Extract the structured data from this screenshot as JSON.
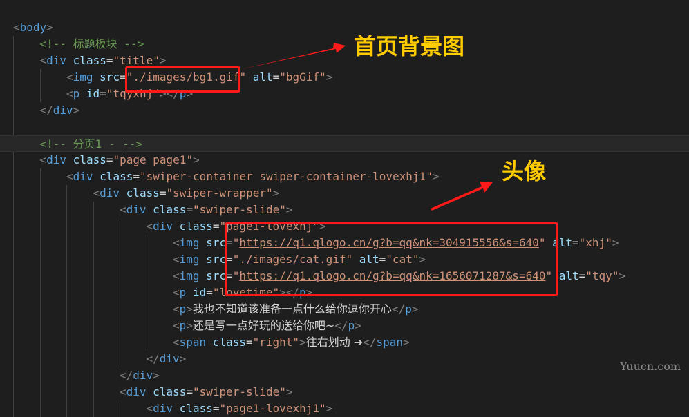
{
  "editor": {
    "lines": [
      {
        "tokens": [
          {
            "c": "tok-punc",
            "t": "<"
          },
          {
            "c": "tok-tag",
            "t": "body"
          },
          {
            "c": "tok-punc",
            "t": ">"
          }
        ]
      },
      {
        "tokens": [
          {
            "c": "tok-comment",
            "t": "<!-- 标题板块 -->"
          }
        ]
      },
      {
        "tokens": [
          {
            "c": "tok-punc",
            "t": "<"
          },
          {
            "c": "tok-tag",
            "t": "div"
          },
          {
            "c": "tok-attr",
            "t": " class"
          },
          {
            "c": "tok-eq",
            "t": "="
          },
          {
            "c": "tok-str",
            "t": "\"title\""
          },
          {
            "c": "tok-punc",
            "t": ">"
          }
        ]
      },
      {
        "tokens": [
          {
            "c": "tok-punc",
            "t": "<"
          },
          {
            "c": "tok-tag",
            "t": "img"
          },
          {
            "c": "tok-attr",
            "t": " src"
          },
          {
            "c": "tok-eq",
            "t": "="
          },
          {
            "c": "tok-str",
            "t": "\"./images/bg1.gif\""
          },
          {
            "c": "tok-attr",
            "t": " alt"
          },
          {
            "c": "tok-eq",
            "t": "="
          },
          {
            "c": "tok-str",
            "t": "\"bgGif\""
          },
          {
            "c": "tok-punc",
            "t": ">"
          }
        ]
      },
      {
        "tokens": [
          {
            "c": "tok-punc",
            "t": "<"
          },
          {
            "c": "tok-tag",
            "t": "p"
          },
          {
            "c": "tok-attr",
            "t": " id"
          },
          {
            "c": "tok-eq",
            "t": "="
          },
          {
            "c": "tok-str",
            "t": "\"tqyxhj\""
          },
          {
            "c": "tok-punc",
            "t": "></"
          },
          {
            "c": "tok-tag",
            "t": "p"
          },
          {
            "c": "tok-punc",
            "t": ">"
          }
        ]
      },
      {
        "tokens": [
          {
            "c": "tok-punc",
            "t": "</"
          },
          {
            "c": "tok-tag",
            "t": "div"
          },
          {
            "c": "tok-punc",
            "t": ">"
          }
        ]
      },
      {
        "tokens": []
      },
      {
        "tokens": [
          {
            "c": "tok-comment",
            "t": "<!-- 分页1 - "
          },
          {
            "c": "cursor",
            "t": ""
          },
          {
            "c": "tok-comment",
            "t": "-->"
          }
        ]
      },
      {
        "tokens": [
          {
            "c": "tok-punc",
            "t": "<"
          },
          {
            "c": "tok-tag",
            "t": "div"
          },
          {
            "c": "tok-attr",
            "t": " class"
          },
          {
            "c": "tok-eq",
            "t": "="
          },
          {
            "c": "tok-str",
            "t": "\"page page1\""
          },
          {
            "c": "tok-punc",
            "t": ">"
          }
        ]
      },
      {
        "tokens": [
          {
            "c": "tok-punc",
            "t": "<"
          },
          {
            "c": "tok-tag",
            "t": "div"
          },
          {
            "c": "tok-attr",
            "t": " class"
          },
          {
            "c": "tok-eq",
            "t": "="
          },
          {
            "c": "tok-str",
            "t": "\"swiper-container swiper-container-lovexhj1\""
          },
          {
            "c": "tok-punc",
            "t": ">"
          }
        ]
      },
      {
        "tokens": [
          {
            "c": "tok-punc",
            "t": "<"
          },
          {
            "c": "tok-tag",
            "t": "div"
          },
          {
            "c": "tok-attr",
            "t": " class"
          },
          {
            "c": "tok-eq",
            "t": "="
          },
          {
            "c": "tok-str",
            "t": "\"swiper-wrapper\""
          },
          {
            "c": "tok-punc",
            "t": ">"
          }
        ]
      },
      {
        "tokens": [
          {
            "c": "tok-punc",
            "t": "<"
          },
          {
            "c": "tok-tag",
            "t": "div"
          },
          {
            "c": "tok-attr",
            "t": " class"
          },
          {
            "c": "tok-eq",
            "t": "="
          },
          {
            "c": "tok-str",
            "t": "\"swiper-slide\""
          },
          {
            "c": "tok-punc",
            "t": ">"
          }
        ]
      },
      {
        "tokens": [
          {
            "c": "tok-punc",
            "t": "<"
          },
          {
            "c": "tok-tag",
            "t": "div"
          },
          {
            "c": "tok-attr",
            "t": " class"
          },
          {
            "c": "tok-eq",
            "t": "="
          },
          {
            "c": "tok-str",
            "t": "\"page1-lovexhj\""
          },
          {
            "c": "tok-punc",
            "t": ">"
          }
        ]
      },
      {
        "tokens": [
          {
            "c": "tok-punc",
            "t": "<"
          },
          {
            "c": "tok-tag",
            "t": "img"
          },
          {
            "c": "tok-attr",
            "t": " src"
          },
          {
            "c": "tok-eq",
            "t": "="
          },
          {
            "c": "tok-str",
            "t": "\""
          },
          {
            "c": "tok-link",
            "t": "https://q1.qlogo.cn/g?b=qq&nk=304915556&s=640"
          },
          {
            "c": "tok-str",
            "t": "\""
          },
          {
            "c": "tok-attr",
            "t": " alt"
          },
          {
            "c": "tok-eq",
            "t": "="
          },
          {
            "c": "tok-str",
            "t": "\"xhj\""
          },
          {
            "c": "tok-punc",
            "t": ">"
          }
        ]
      },
      {
        "tokens": [
          {
            "c": "tok-punc",
            "t": "<"
          },
          {
            "c": "tok-tag",
            "t": "img"
          },
          {
            "c": "tok-attr",
            "t": " src"
          },
          {
            "c": "tok-eq",
            "t": "="
          },
          {
            "c": "tok-str",
            "t": "\""
          },
          {
            "c": "tok-link",
            "t": "./images/cat.gif"
          },
          {
            "c": "tok-str",
            "t": "\""
          },
          {
            "c": "tok-attr",
            "t": " alt"
          },
          {
            "c": "tok-eq",
            "t": "="
          },
          {
            "c": "tok-str",
            "t": "\"cat\""
          },
          {
            "c": "tok-punc",
            "t": ">"
          }
        ]
      },
      {
        "tokens": [
          {
            "c": "tok-punc",
            "t": "<"
          },
          {
            "c": "tok-tag",
            "t": "img"
          },
          {
            "c": "tok-attr",
            "t": " src"
          },
          {
            "c": "tok-eq",
            "t": "="
          },
          {
            "c": "tok-str",
            "t": "\""
          },
          {
            "c": "tok-link",
            "t": "https://q1.qlogo.cn/g?b=qq&nk=1656071287&s=640"
          },
          {
            "c": "tok-str",
            "t": "\""
          },
          {
            "c": "tok-attr",
            "t": " alt"
          },
          {
            "c": "tok-eq",
            "t": "="
          },
          {
            "c": "tok-str",
            "t": "\"tqy\""
          },
          {
            "c": "tok-punc",
            "t": ">"
          }
        ]
      },
      {
        "tokens": [
          {
            "c": "tok-punc",
            "t": "<"
          },
          {
            "c": "tok-tag",
            "t": "p"
          },
          {
            "c": "tok-attr",
            "t": " id"
          },
          {
            "c": "tok-eq",
            "t": "="
          },
          {
            "c": "tok-str",
            "t": "\"lovetime\""
          },
          {
            "c": "tok-punc",
            "t": "></"
          },
          {
            "c": "tok-tag",
            "t": "p"
          },
          {
            "c": "tok-punc",
            "t": ">"
          }
        ]
      },
      {
        "tokens": [
          {
            "c": "tok-punc",
            "t": "<"
          },
          {
            "c": "tok-tag",
            "t": "p"
          },
          {
            "c": "tok-punc",
            "t": ">"
          },
          {
            "c": "tok-text",
            "t": "我也不知道该准备一点什么给你逗你开心"
          },
          {
            "c": "tok-punc",
            "t": "</"
          },
          {
            "c": "tok-tag",
            "t": "p"
          },
          {
            "c": "tok-punc",
            "t": ">"
          }
        ]
      },
      {
        "tokens": [
          {
            "c": "tok-punc",
            "t": "<"
          },
          {
            "c": "tok-tag",
            "t": "p"
          },
          {
            "c": "tok-punc",
            "t": ">"
          },
          {
            "c": "tok-text",
            "t": "还是写一点好玩的送给你吧~"
          },
          {
            "c": "tok-punc",
            "t": "</"
          },
          {
            "c": "tok-tag",
            "t": "p"
          },
          {
            "c": "tok-punc",
            "t": ">"
          }
        ]
      },
      {
        "tokens": [
          {
            "c": "tok-punc",
            "t": "<"
          },
          {
            "c": "tok-tag",
            "t": "span"
          },
          {
            "c": "tok-attr",
            "t": " class"
          },
          {
            "c": "tok-eq",
            "t": "="
          },
          {
            "c": "tok-str",
            "t": "\"right\""
          },
          {
            "c": "tok-punc",
            "t": ">"
          },
          {
            "c": "tok-text",
            "t": "往右划动 ➔"
          },
          {
            "c": "tok-punc",
            "t": "</"
          },
          {
            "c": "tok-tag",
            "t": "span"
          },
          {
            "c": "tok-punc",
            "t": ">"
          }
        ]
      },
      {
        "tokens": [
          {
            "c": "tok-punc",
            "t": "</"
          },
          {
            "c": "tok-tag",
            "t": "div"
          },
          {
            "c": "tok-punc",
            "t": ">"
          }
        ]
      },
      {
        "tokens": [
          {
            "c": "tok-punc",
            "t": "</"
          },
          {
            "c": "tok-tag",
            "t": "div"
          },
          {
            "c": "tok-punc",
            "t": ">"
          }
        ]
      },
      {
        "tokens": [
          {
            "c": "tok-punc",
            "t": "<"
          },
          {
            "c": "tok-tag",
            "t": "div"
          },
          {
            "c": "tok-attr",
            "t": " class"
          },
          {
            "c": "tok-eq",
            "t": "="
          },
          {
            "c": "tok-str",
            "t": "\"swiper-slide\""
          },
          {
            "c": "tok-punc",
            "t": ">"
          }
        ]
      },
      {
        "tokens": [
          {
            "c": "tok-punc",
            "t": "<"
          },
          {
            "c": "tok-tag",
            "t": "div"
          },
          {
            "c": "tok-attr",
            "t": " class"
          },
          {
            "c": "tok-eq",
            "t": "="
          },
          {
            "c": "tok-str",
            "t": "\"page1-lovexhj1\""
          },
          {
            "c": "tok-punc",
            "t": ">"
          }
        ]
      }
    ]
  },
  "annotations": {
    "callout_background": "首页背景图",
    "callout_avatar": "头像",
    "highlight_color": "#ff1a1a",
    "callout_color": "#ffcc00"
  },
  "watermark": "Yuucn.com"
}
